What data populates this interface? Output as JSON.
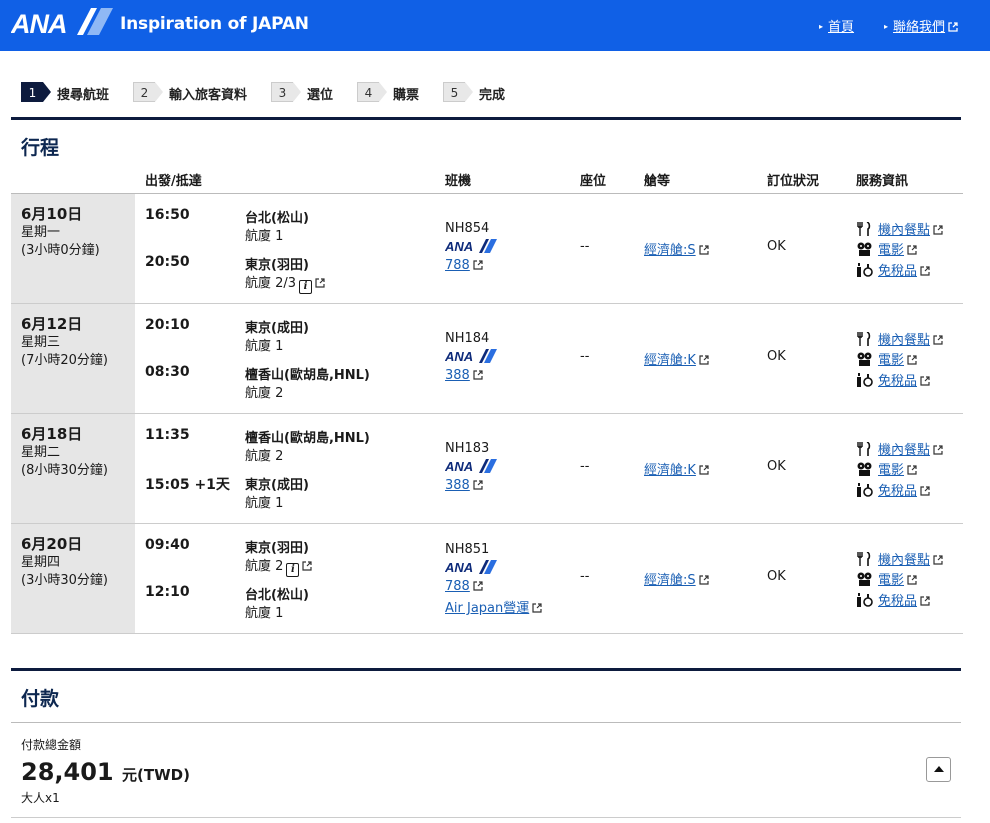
{
  "header": {
    "brand": "ANA",
    "tagline": "Inspiration of JAPAN",
    "home_label": "首頁",
    "contact_label": "聯絡我們",
    "bg_color": "#1060e6"
  },
  "steps": [
    {
      "num": "1",
      "label": "搜尋航班",
      "active": true
    },
    {
      "num": "2",
      "label": "輸入旅客資料",
      "active": false
    },
    {
      "num": "3",
      "label": "選位",
      "active": false
    },
    {
      "num": "4",
      "label": "購票",
      "active": false
    },
    {
      "num": "5",
      "label": "完成",
      "active": false
    }
  ],
  "itinerary": {
    "title": "行程",
    "columns": {
      "depart_arrive": "出發/抵達",
      "flight": "班機",
      "seat": "座位",
      "cabin": "艙等",
      "status": "訂位狀況",
      "services": "服務資訊"
    },
    "rows": [
      {
        "date": "6月10日",
        "weekday": "星期一",
        "duration": "(3小時0分鐘)",
        "dep_time": "16:50",
        "dep_place": "台北(松山)",
        "dep_terminal": "航廈 1",
        "arr_time": "20:50",
        "arr_place": "東京(羽田)",
        "arr_terminal": "航廈 2/3",
        "flight_no": "NH854",
        "aircraft": "788",
        "operator": "",
        "seat": "--",
        "cabin": "經濟艙:S",
        "status": "OK",
        "services": [
          "機內餐點",
          "電影",
          "免稅品"
        ]
      },
      {
        "date": "6月12日",
        "weekday": "星期三",
        "duration": "(7小時20分鐘)",
        "dep_time": "20:10",
        "dep_place": "東京(成田)",
        "dep_terminal": "航廈 1",
        "arr_time": "08:30",
        "arr_place": "檀香山(歐胡島,HNL)",
        "arr_terminal": "航廈 2",
        "flight_no": "NH184",
        "aircraft": "388",
        "operator": "",
        "seat": "--",
        "cabin": "經濟艙:K",
        "status": "OK",
        "services": [
          "機內餐點",
          "電影",
          "免稅品"
        ]
      },
      {
        "date": "6月18日",
        "weekday": "星期二",
        "duration": "(8小時30分鐘)",
        "dep_time": "11:35",
        "dep_place": "檀香山(歐胡島,HNL)",
        "dep_terminal": "航廈 2",
        "arr_time": "15:05 +1天",
        "arr_place": "東京(成田)",
        "arr_terminal": "航廈 1",
        "flight_no": "NH183",
        "aircraft": "388",
        "operator": "",
        "seat": "--",
        "cabin": "經濟艙:K",
        "status": "OK",
        "services": [
          "機內餐點",
          "電影",
          "免稅品"
        ]
      },
      {
        "date": "6月20日",
        "weekday": "星期四",
        "duration": "(3小時30分鐘)",
        "dep_time": "09:40",
        "dep_place": "東京(羽田)",
        "dep_terminal": "航廈 2",
        "arr_time": "12:10",
        "arr_place": "台北(松山)",
        "arr_terminal": "航廈 1",
        "flight_no": "NH851",
        "aircraft": "788",
        "operator": "Air Japan營運",
        "seat": "--",
        "cabin": "經濟艙:S",
        "status": "OK",
        "services": [
          "機內餐點",
          "電影",
          "免稅品"
        ]
      }
    ]
  },
  "payment": {
    "title": "付款",
    "total_label": "付款總金額",
    "amount": "28,401",
    "unit": "元(TWD)",
    "passengers": "大人x1"
  }
}
